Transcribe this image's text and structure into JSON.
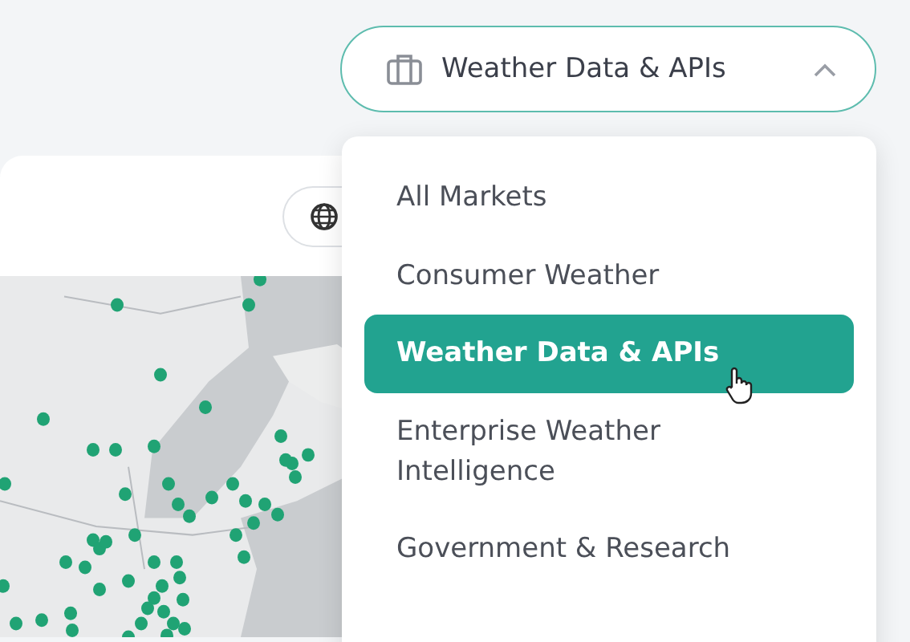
{
  "market_selector": {
    "label": "Weather Data & APIs",
    "expanded": true
  },
  "market_menu": {
    "items": [
      {
        "label": "All Markets",
        "selected": false
      },
      {
        "label": "Consumer Weather",
        "selected": false
      },
      {
        "label": "Weather Data & APIs",
        "selected": true
      },
      {
        "label": "Enterprise Weather Intelligence",
        "selected": false
      },
      {
        "label": "Government & Research",
        "selected": false
      }
    ]
  }
}
